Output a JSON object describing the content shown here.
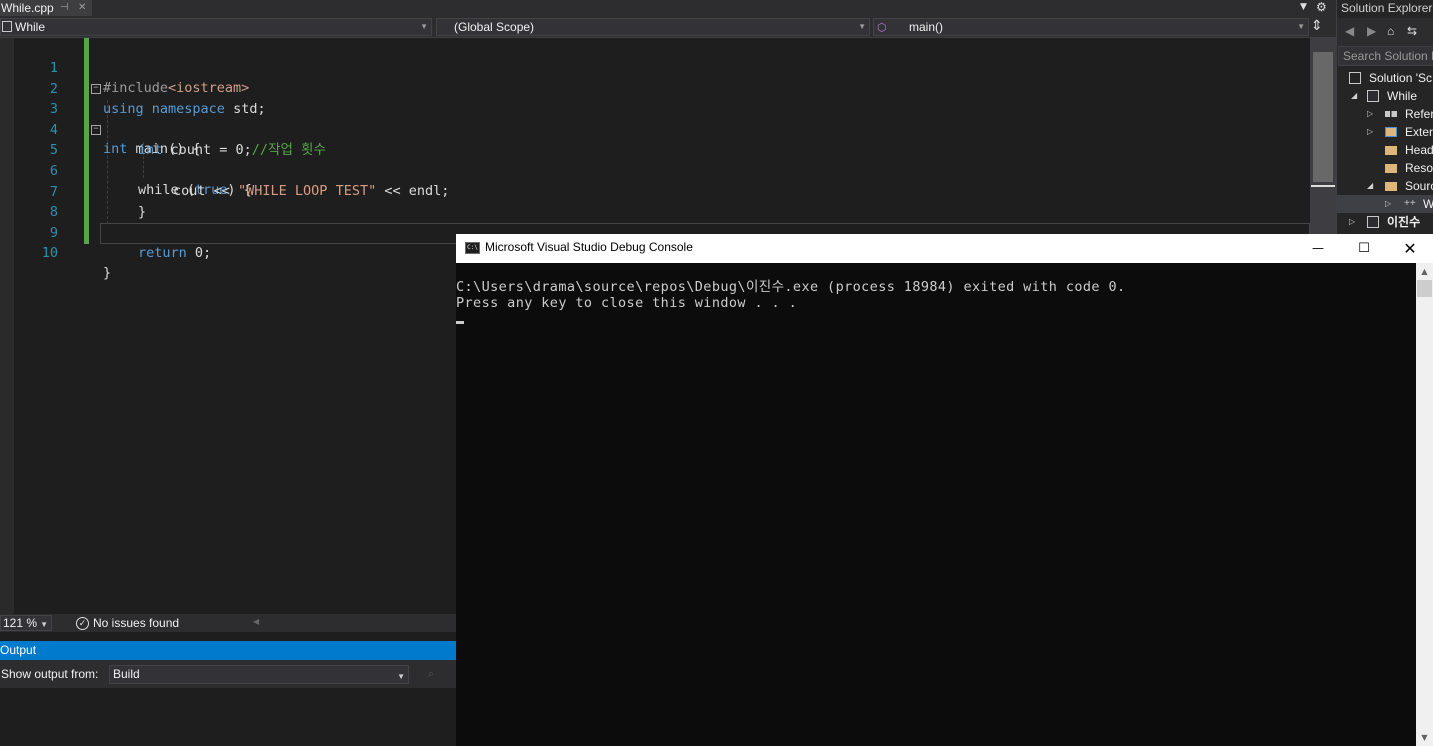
{
  "tab": {
    "label": "While.cpp",
    "pin": "⊣",
    "close": "✕"
  },
  "navbar": {
    "project": "While",
    "scope": "(Global Scope)",
    "member": "main()"
  },
  "editor": {
    "lines": [
      {
        "no": "1"
      },
      {
        "no": "2"
      },
      {
        "no": "3"
      },
      {
        "no": "4"
      },
      {
        "no": "5"
      },
      {
        "no": "6"
      },
      {
        "no": "7"
      },
      {
        "no": "8"
      },
      {
        "no": "9"
      },
      {
        "no": "10"
      }
    ],
    "code": {
      "l1_directive": "#include",
      "l1_header": "<iostream>",
      "l2_using": "using",
      "l2_namespace": "namespace",
      "l2_rest": " std;",
      "l3_int": "int",
      "l3_rest": " main() {",
      "l4_int": "int",
      "l4_rest": " count = 0;",
      "l4_comment": "//작업 횟수",
      "l5_while": "while",
      "l5_open": " (",
      "l5_true": "true",
      "l5_close": ") {",
      "l6_cout": "cout << ",
      "l6_str": "\"WHILE LOOP TEST\"",
      "l6_rest": " << endl;",
      "l7": "}",
      "l9_return": "return",
      "l9_rest": " 0;",
      "l10": "}"
    }
  },
  "status": {
    "zoom": "121 %",
    "issues": "No issues found"
  },
  "output": {
    "title": "Output",
    "show_from_label": "Show output from:",
    "source": "Build"
  },
  "solution_explorer": {
    "title": "Solution Explorer",
    "search_placeholder": "Search Solution Explorer",
    "items": [
      {
        "label": "Solution 'Sc"
      },
      {
        "label": "While"
      },
      {
        "label": "References"
      },
      {
        "label": "External Dependencies"
      },
      {
        "label": "Header Files"
      },
      {
        "label": "Resource Files"
      },
      {
        "label": "Source Files"
      },
      {
        "label": "While.cpp"
      },
      {
        "label": "이진수"
      }
    ]
  },
  "console": {
    "title": "Microsoft Visual Studio Debug Console",
    "line1": "C:\\Users\\drama\\source\\repos\\Debug\\이진수.exe (process 18984) exited with code 0.",
    "line2": "Press any key to close this window . . ."
  },
  "colors": {
    "keyword": "#569cd6",
    "string": "#d69d85",
    "comment": "#57a64a",
    "line_number": "#2b91af",
    "accent": "#007acc"
  },
  "icons": [
    "pin-icon",
    "close-icon",
    "gear-icon",
    "split-icon",
    "check-circle-icon",
    "console-app-icon",
    "minimize-icon",
    "maximize-icon",
    "window-close-icon"
  ]
}
